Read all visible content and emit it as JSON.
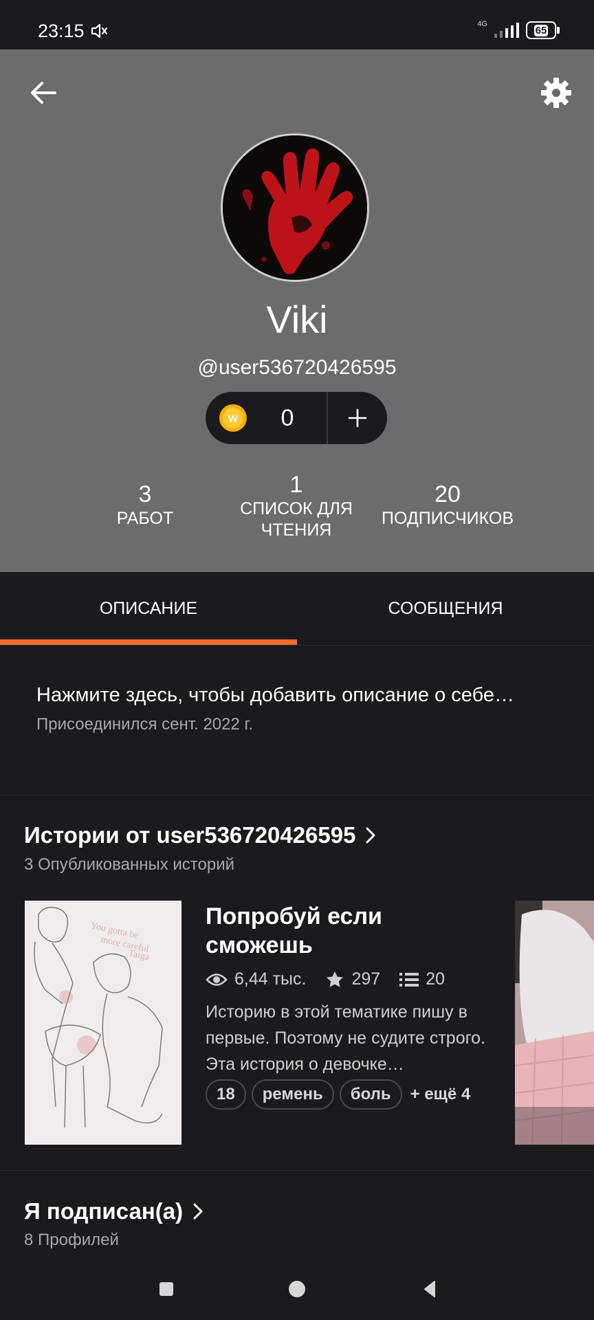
{
  "status_bar": {
    "time": "23:15",
    "network": "4G",
    "battery": "65"
  },
  "profile": {
    "name": "Viki",
    "handle": "@user536720426595",
    "coins": "0",
    "stats": [
      {
        "value": "3",
        "label_line1": "РАБОТ",
        "label_line2": ""
      },
      {
        "value": "1",
        "label_line1": "СПИСОК ДЛЯ",
        "label_line2": "ЧТЕНИЯ"
      },
      {
        "value": "20",
        "label_line1": "ПОДПИСЧИКОВ",
        "label_line2": ""
      }
    ]
  },
  "tabs": [
    {
      "label": "ОПИСАНИЕ",
      "active": true
    },
    {
      "label": "СООБЩЕНИЯ",
      "active": false
    }
  ],
  "description": {
    "text": "Нажмите здесь, чтобы добавить описание о себе…",
    "joined": "Присоединился сент. 2022 г."
  },
  "stories": {
    "title": "Истории от user536720426595",
    "subtitle": "3 Опубликованных историй",
    "items": [
      {
        "title": "Попробуй если сможешь",
        "reads": "6,44 тыс.",
        "votes": "297",
        "parts": "20",
        "description": "Историю в этой тематике пишу в первые. Поэтому не судите строго. Эта история о девочке…",
        "tags": [
          "18",
          "ремень",
          "боль"
        ],
        "more_tags": "+ ещё 4"
      }
    ]
  },
  "following": {
    "title": "Я подписан(а)",
    "subtitle": "8 Профилей"
  },
  "colors": {
    "header_bg": "#6c6b6d",
    "page_bg": "#1b1a1e",
    "accent": "#f26a2e"
  }
}
